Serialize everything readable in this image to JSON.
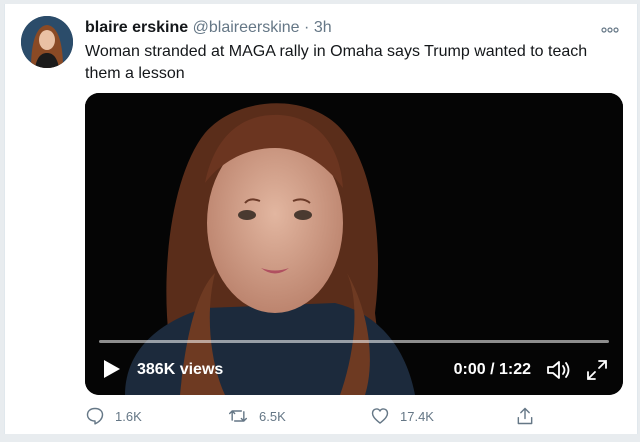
{
  "tweet": {
    "display_name": "blaire erskine",
    "handle": "@blaireerskine",
    "separator": "·",
    "time": "3h",
    "text": "Woman stranded at MAGA rally in Omaha says Trump wanted to teach them a lesson",
    "more_icon": "more-options-icon"
  },
  "video": {
    "views": "386K views",
    "duration": "0:00 / 1:22",
    "progress": 0,
    "icons": [
      "play-icon",
      "volume-icon",
      "fullscreen-icon"
    ]
  },
  "actions": {
    "replies": "1.6K",
    "retweets": "6.5K",
    "likes": "17.4K",
    "icons": [
      "reply-icon",
      "retweet-icon",
      "like-icon",
      "share-icon"
    ]
  },
  "colors": {
    "text": "#14171a",
    "secondary": "#657786",
    "accent": "#1da1f2",
    "video_bg": "#050505"
  }
}
